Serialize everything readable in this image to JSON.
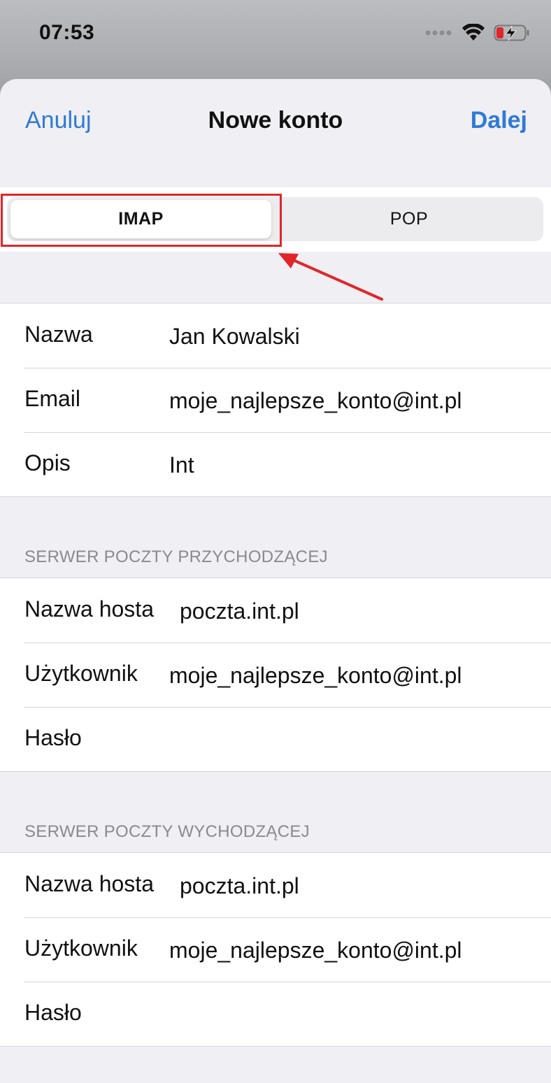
{
  "status_bar": {
    "time": "07:53",
    "icons": [
      "cellular-dots-icon",
      "wifi-icon",
      "battery-charging-icon"
    ]
  },
  "nav": {
    "cancel_label": "Anuluj",
    "title": "Nowe konto",
    "next_label": "Dalej"
  },
  "segmented": {
    "options": [
      "IMAP",
      "POP"
    ],
    "selected": "IMAP"
  },
  "account": {
    "rows": [
      {
        "label": "Nazwa",
        "value": "Jan Kowalski"
      },
      {
        "label": "Email",
        "value": "moje_najlepsze_konto@int.pl"
      },
      {
        "label": "Opis",
        "value": "Int"
      }
    ]
  },
  "incoming": {
    "header": "SERWER POCZTY PRZYCHODZĄCEJ",
    "rows": [
      {
        "label": "Nazwa hosta",
        "value": "poczta.int.pl"
      },
      {
        "label": "Użytkownik",
        "value": "moje_najlepsze_konto@int.pl"
      },
      {
        "label": "Hasło",
        "value": ""
      }
    ]
  },
  "outgoing": {
    "header": "SERWER POCZTY WYCHODZĄCEJ",
    "rows": [
      {
        "label": "Nazwa hosta",
        "value": "poczta.int.pl"
      },
      {
        "label": "Użytkownik",
        "value": "moje_najlepsze_konto@int.pl"
      },
      {
        "label": "Hasło",
        "value": ""
      }
    ]
  },
  "colors": {
    "accent": "#2f7ad6",
    "annotation": "#e0262a",
    "battery_low": "#e0262a"
  }
}
